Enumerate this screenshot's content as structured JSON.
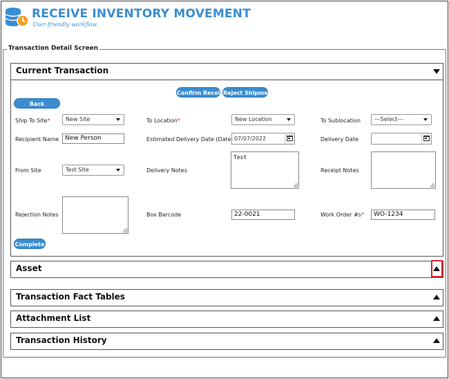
{
  "header": {
    "title": "RECEIVE INVENTORY MOVEMENT",
    "subtitle": "User-friendly workflow",
    "accent_color": "#3a8dd1",
    "logo_icon": "database-clock-icon"
  },
  "screen": {
    "legend": "Transaction Detail Screen"
  },
  "sections": {
    "current": {
      "title": "Current Transaction",
      "state": "expanded"
    },
    "asset": {
      "title": "Asset",
      "state": "collapsed",
      "highlight_color": "#d6262b"
    },
    "fact_tables": {
      "title": "Transaction Fact Tables",
      "state": "collapsed"
    },
    "attachments": {
      "title": "Attachment List",
      "state": "collapsed"
    },
    "history": {
      "title": "Transaction History",
      "state": "collapsed"
    }
  },
  "buttons": {
    "confirm_receipt": "Confirm Receipt",
    "reject_shipment": "Reject Shipment",
    "back": "Back",
    "complete": "Complete"
  },
  "form": {
    "ship_to_site": {
      "label": "Ship To Site",
      "required": "*",
      "value": "New Site"
    },
    "to_location": {
      "label": "To Location",
      "required": "*",
      "value": "New Location"
    },
    "to_sublocation": {
      "label": "To Sublocation",
      "value": "---Select---"
    },
    "recipient_name": {
      "label": "Recipient Name",
      "value": "New Person"
    },
    "estimated_delivery_date": {
      "label": "Estimated Delivery Date (Date)",
      "value": "07/07/2022"
    },
    "delivery_date": {
      "label": "Delivery Date",
      "value": ""
    },
    "from_site": {
      "label": "From Site",
      "value": "Test Site"
    },
    "delivery_notes": {
      "label": "Delivery Notes",
      "value": "Test"
    },
    "receipt_notes": {
      "label": "Receipt Notes",
      "value": ""
    },
    "rejection_notes": {
      "label": "Rejection Notes",
      "value": ""
    },
    "box_barcode": {
      "label": "Box Barcode",
      "value": "22-0021"
    },
    "work_order": {
      "label": "Work Order #s",
      "required": "*",
      "value": "WO-1234"
    }
  }
}
